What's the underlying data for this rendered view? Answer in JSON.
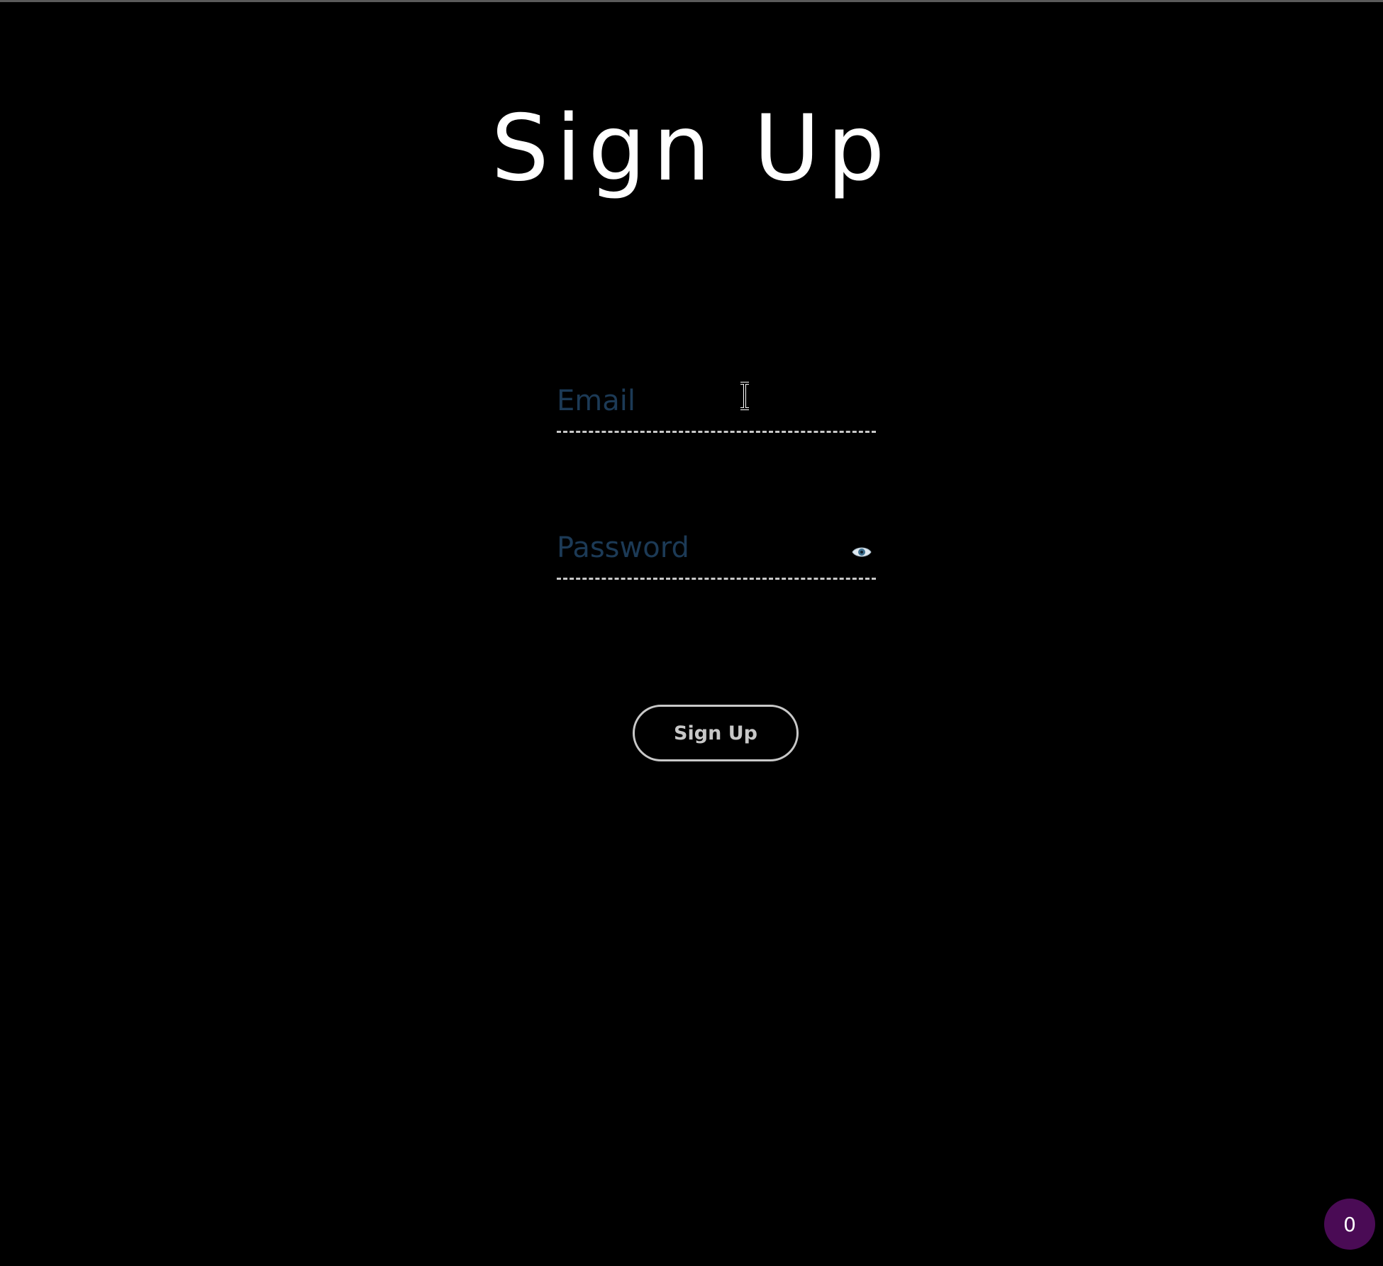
{
  "page": {
    "title": "Sign Up"
  },
  "form": {
    "email": {
      "placeholder": "Email",
      "value": ""
    },
    "password": {
      "placeholder": "Password",
      "value": "",
      "toggle_icon": "eye-icon"
    },
    "submit_label": "Sign Up"
  },
  "badge": {
    "count": "0"
  },
  "colors": {
    "background": "#000000",
    "title": "#ffffff",
    "placeholder": "#1c3a56",
    "field_border": "#c8c8c8",
    "button_border": "#c8c8c8",
    "badge_background": "#4a0b55"
  }
}
